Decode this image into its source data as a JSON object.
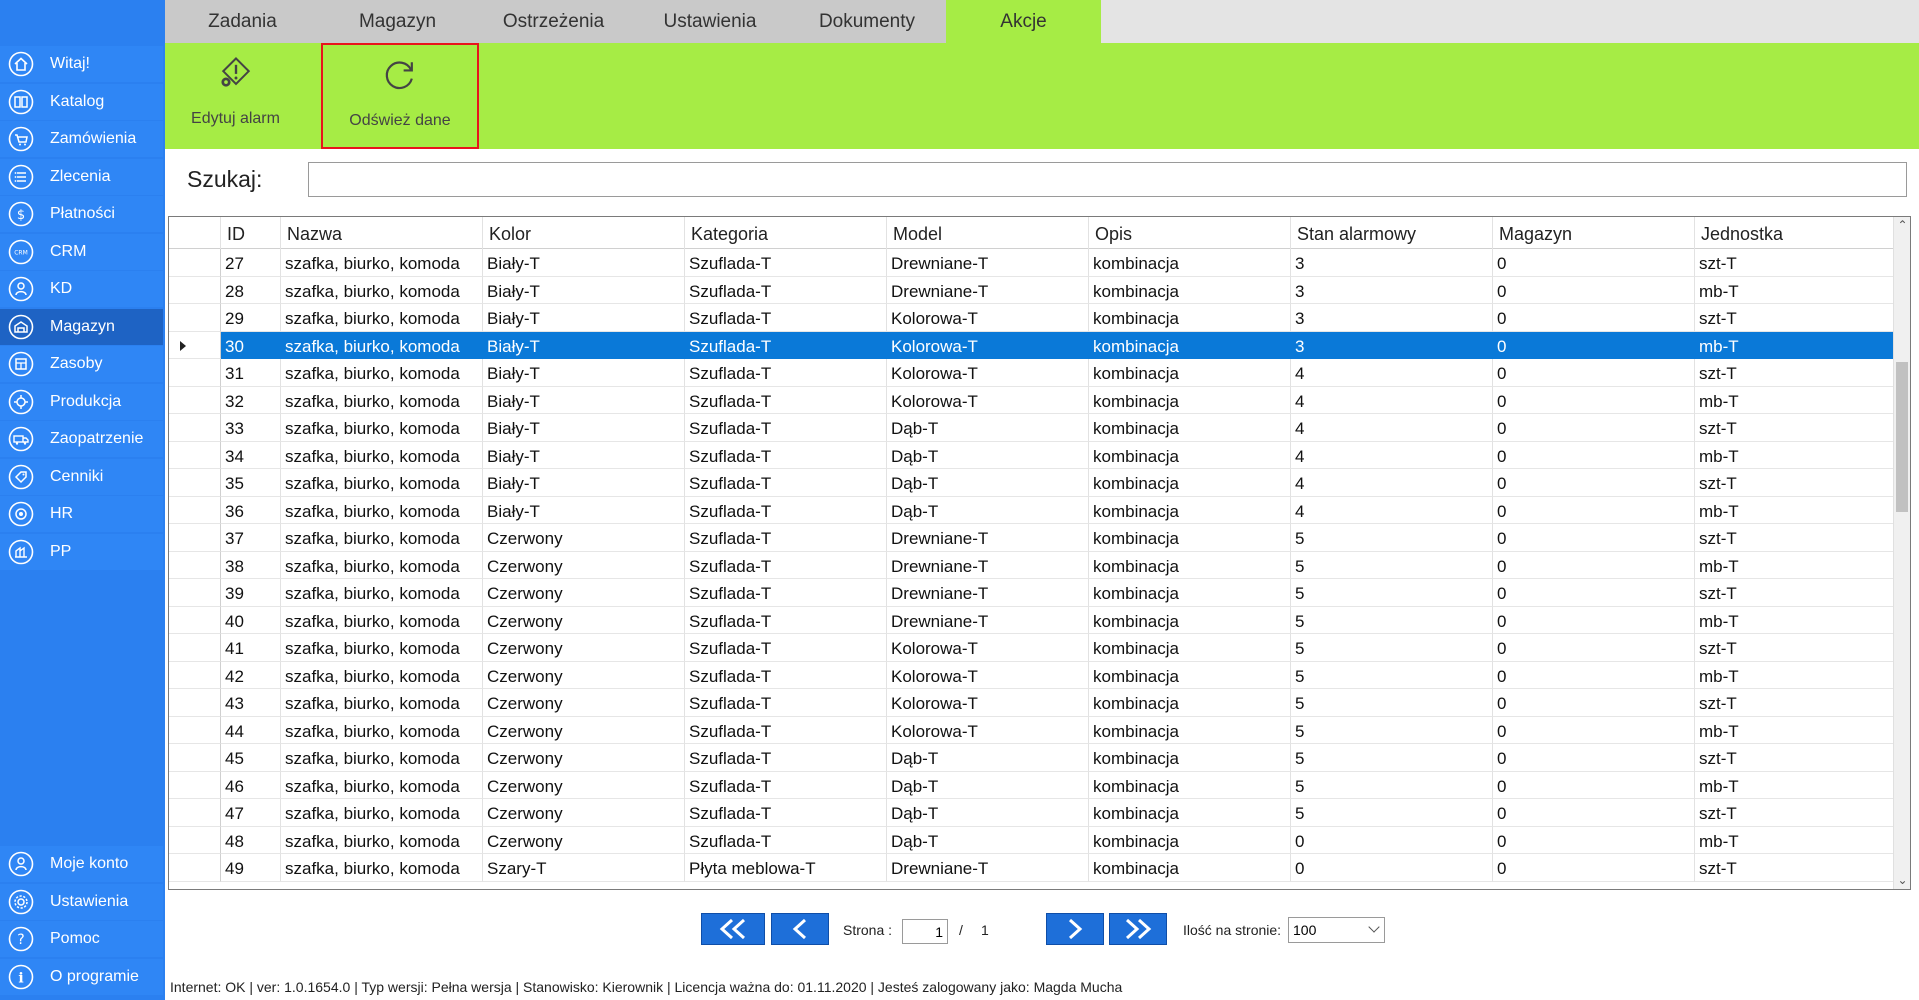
{
  "sidebar": {
    "top_items": [
      {
        "label": "Witaj!",
        "icon": "home-icon"
      },
      {
        "label": "Katalog",
        "icon": "book-icon"
      },
      {
        "label": "Zamówienia",
        "icon": "cart-icon"
      },
      {
        "label": "Zlecenia",
        "icon": "list-icon"
      },
      {
        "label": "Płatności",
        "icon": "dollar-icon"
      },
      {
        "label": "CRM",
        "icon": "crm-icon"
      },
      {
        "label": "KD",
        "icon": "person-icon"
      },
      {
        "label": "Magazyn",
        "icon": "warehouse-icon",
        "active": true
      },
      {
        "label": "Zasoby",
        "icon": "resources-icon"
      },
      {
        "label": "Produkcja",
        "icon": "production-icon"
      },
      {
        "label": "Zaopatrzenie",
        "icon": "truck-icon"
      },
      {
        "label": "Cenniki",
        "icon": "price-tag-icon"
      },
      {
        "label": "HR",
        "icon": "hr-icon"
      },
      {
        "label": "PP",
        "icon": "pp-icon"
      }
    ],
    "bottom_items": [
      {
        "label": "Moje konto",
        "icon": "account-icon"
      },
      {
        "label": "Ustawienia",
        "icon": "settings-icon"
      },
      {
        "label": "Pomoc",
        "icon": "help-icon"
      },
      {
        "label": "O programie",
        "icon": "info-icon"
      }
    ]
  },
  "tabs": [
    {
      "label": "Zadania"
    },
    {
      "label": "Magazyn"
    },
    {
      "label": "Ostrzeżenia"
    },
    {
      "label": "Ustawienia"
    },
    {
      "label": "Dokumenty"
    },
    {
      "label": "Akcje",
      "active": true
    }
  ],
  "ribbon": {
    "edit_alarm": {
      "label": "Edytuj alarm",
      "icon": "alarm-edit-icon"
    },
    "refresh": {
      "label": "Odśwież dane",
      "icon": "refresh-icon",
      "highlight_color": "#e8141c"
    }
  },
  "search": {
    "label": "Szukaj:",
    "value": ""
  },
  "grid": {
    "columns": [
      "ID",
      "Nazwa",
      "Kolor",
      "Kategoria",
      "Model",
      "Opis",
      "Stan alarmowy",
      "Magazyn",
      "Jednostka"
    ],
    "selected_id": "30",
    "rows": [
      [
        "27",
        "szafka, biurko, komoda",
        "Biały-T",
        "Szuflada-T",
        "Drewniane-T",
        "kombinacja",
        "3",
        "0",
        "szt-T"
      ],
      [
        "28",
        "szafka, biurko, komoda",
        "Biały-T",
        "Szuflada-T",
        "Drewniane-T",
        "kombinacja",
        "3",
        "0",
        "mb-T"
      ],
      [
        "29",
        "szafka, biurko, komoda",
        "Biały-T",
        "Szuflada-T",
        "Kolorowa-T",
        "kombinacja",
        "3",
        "0",
        "szt-T"
      ],
      [
        "30",
        "szafka, biurko, komoda",
        "Biały-T",
        "Szuflada-T",
        "Kolorowa-T",
        "kombinacja",
        "3",
        "0",
        "mb-T"
      ],
      [
        "31",
        "szafka, biurko, komoda",
        "Biały-T",
        "Szuflada-T",
        "Kolorowa-T",
        "kombinacja",
        "4",
        "0",
        "szt-T"
      ],
      [
        "32",
        "szafka, biurko, komoda",
        "Biały-T",
        "Szuflada-T",
        "Kolorowa-T",
        "kombinacja",
        "4",
        "0",
        "mb-T"
      ],
      [
        "33",
        "szafka, biurko, komoda",
        "Biały-T",
        "Szuflada-T",
        "Dąb-T",
        "kombinacja",
        "4",
        "0",
        "szt-T"
      ],
      [
        "34",
        "szafka, biurko, komoda",
        "Biały-T",
        "Szuflada-T",
        "Dąb-T",
        "kombinacja",
        "4",
        "0",
        "mb-T"
      ],
      [
        "35",
        "szafka, biurko, komoda",
        "Biały-T",
        "Szuflada-T",
        "Dąb-T",
        "kombinacja",
        "4",
        "0",
        "szt-T"
      ],
      [
        "36",
        "szafka, biurko, komoda",
        "Biały-T",
        "Szuflada-T",
        "Dąb-T",
        "kombinacja",
        "4",
        "0",
        "mb-T"
      ],
      [
        "37",
        "szafka, biurko, komoda",
        "Czerwony",
        "Szuflada-T",
        "Drewniane-T",
        "kombinacja",
        "5",
        "0",
        "szt-T"
      ],
      [
        "38",
        "szafka, biurko, komoda",
        "Czerwony",
        "Szuflada-T",
        "Drewniane-T",
        "kombinacja",
        "5",
        "0",
        "mb-T"
      ],
      [
        "39",
        "szafka, biurko, komoda",
        "Czerwony",
        "Szuflada-T",
        "Drewniane-T",
        "kombinacja",
        "5",
        "0",
        "szt-T"
      ],
      [
        "40",
        "szafka, biurko, komoda",
        "Czerwony",
        "Szuflada-T",
        "Drewniane-T",
        "kombinacja",
        "5",
        "0",
        "mb-T"
      ],
      [
        "41",
        "szafka, biurko, komoda",
        "Czerwony",
        "Szuflada-T",
        "Kolorowa-T",
        "kombinacja",
        "5",
        "0",
        "szt-T"
      ],
      [
        "42",
        "szafka, biurko, komoda",
        "Czerwony",
        "Szuflada-T",
        "Kolorowa-T",
        "kombinacja",
        "5",
        "0",
        "mb-T"
      ],
      [
        "43",
        "szafka, biurko, komoda",
        "Czerwony",
        "Szuflada-T",
        "Kolorowa-T",
        "kombinacja",
        "5",
        "0",
        "szt-T"
      ],
      [
        "44",
        "szafka, biurko, komoda",
        "Czerwony",
        "Szuflada-T",
        "Kolorowa-T",
        "kombinacja",
        "5",
        "0",
        "mb-T"
      ],
      [
        "45",
        "szafka, biurko, komoda",
        "Czerwony",
        "Szuflada-T",
        "Dąb-T",
        "kombinacja",
        "5",
        "0",
        "szt-T"
      ],
      [
        "46",
        "szafka, biurko, komoda",
        "Czerwony",
        "Szuflada-T",
        "Dąb-T",
        "kombinacja",
        "5",
        "0",
        "mb-T"
      ],
      [
        "47",
        "szafka, biurko, komoda",
        "Czerwony",
        "Szuflada-T",
        "Dąb-T",
        "kombinacja",
        "5",
        "0",
        "szt-T"
      ],
      [
        "48",
        "szafka, biurko, komoda",
        "Czerwony",
        "Szuflada-T",
        "Dąb-T",
        "kombinacja",
        "0",
        "0",
        "mb-T"
      ],
      [
        "49",
        "szafka, biurko, komoda",
        "Szary-T",
        "Płyta meblowa-T",
        "Drewniane-T",
        "kombinacja",
        "0",
        "0",
        "szt-T"
      ]
    ]
  },
  "pager": {
    "page_label": "Strona :",
    "current_page": "1",
    "separator": "/",
    "total_pages": "1",
    "per_page_label": "Ilość na stronie:",
    "per_page_value": "100"
  },
  "status": {
    "text": "Internet: OK  |   ver: 1.0.1654.0   |   Typ wersji: Pełna wersja   |   Stanowisko: Kierownik   |   Licencja ważna do: 01.11.2020   |   Jesteś zalogowany jako: Magda Mucha"
  },
  "colors": {
    "sidebar": "#2b80f0",
    "ribbon": "#a6ec45",
    "selection": "#0a79d8",
    "pager_button": "#1e6fd9"
  }
}
